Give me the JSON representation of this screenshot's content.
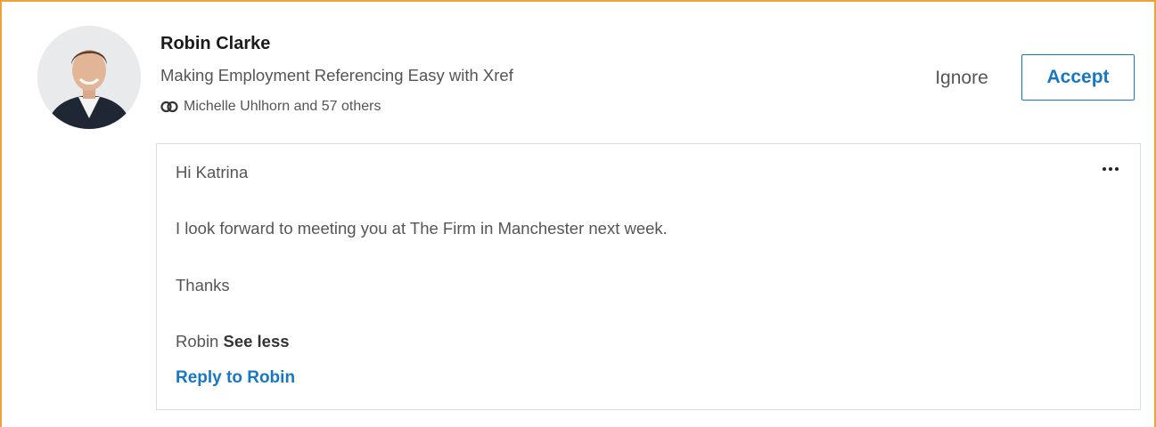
{
  "invitation": {
    "name": "Robin Clarke",
    "headline": "Making Employment Referencing Easy with Xref",
    "mutual_connections": "Michelle Uhlhorn and 57 others",
    "avatar_icon": "profile-photo",
    "mutual_icon": "mutual-connections-icon"
  },
  "actions": {
    "ignore_label": "Ignore",
    "accept_label": "Accept"
  },
  "message": {
    "greeting": "Hi Katrina",
    "body": "I look forward to meeting you at The Firm in Manchester next week.",
    "closing": "Thanks",
    "signature": "Robin",
    "see_less_label": "See less",
    "more_icon": "more-options-icon",
    "reply_label": "Reply to Robin"
  },
  "colors": {
    "accent": "#1877c4",
    "frame_border": "#f0a23a",
    "text_secondary": "#555555"
  }
}
